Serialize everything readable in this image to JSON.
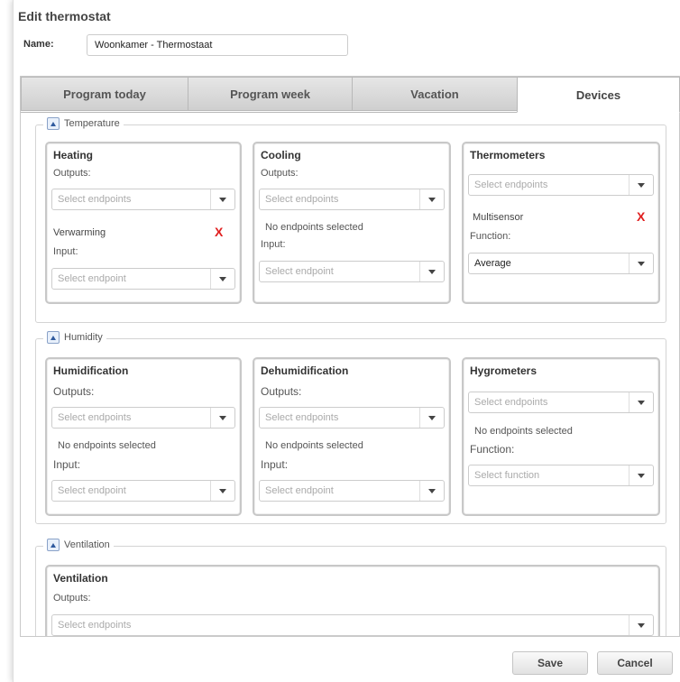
{
  "dialog": {
    "title": "Edit thermostat"
  },
  "name": {
    "label": "Name:",
    "value": "Woonkamer - Thermostaat"
  },
  "tabs": [
    {
      "label": "Program today"
    },
    {
      "label": "Program week"
    },
    {
      "label": "Vacation"
    },
    {
      "label": "Devices"
    }
  ],
  "active_tab": "Devices",
  "temperature": {
    "legend": "Temperature",
    "heating": {
      "title": "Heating",
      "outputs_label": "Outputs:",
      "outputs_placeholder": "Select endpoints",
      "item": "Verwarming",
      "remove": "X",
      "input_label": "Input:",
      "input_placeholder": "Select endpoint"
    },
    "cooling": {
      "title": "Cooling",
      "outputs_label": "Outputs:",
      "outputs_placeholder": "Select endpoints",
      "none_text": "No endpoints selected",
      "input_label": "Input:",
      "input_placeholder": "Select endpoint"
    },
    "thermometers": {
      "title": "Thermometers",
      "select_placeholder": "Select endpoints",
      "item": "Multisensor",
      "remove": "X",
      "function_label": "Function:",
      "function_value": "Average"
    }
  },
  "humidity": {
    "legend": "Humidity",
    "humidification": {
      "title": "Humidification",
      "outputs_label": "Outputs:",
      "outputs_placeholder": "Select endpoints",
      "none_text": "No endpoints selected",
      "input_label": "Input:",
      "input_placeholder": "Select endpoint"
    },
    "dehumidification": {
      "title": "Dehumidification",
      "outputs_label": "Outputs:",
      "outputs_placeholder": "Select endpoints",
      "none_text": "No endpoints selected",
      "input_label": "Input:",
      "input_placeholder": "Select endpoint"
    },
    "hygrometers": {
      "title": "Hygrometers",
      "select_placeholder": "Select endpoints",
      "none_text": "No endpoints selected",
      "function_label": "Function:",
      "function_placeholder": "Select function"
    }
  },
  "ventilation": {
    "legend": "Ventilation",
    "card": {
      "title": "Ventilation",
      "outputs_label": "Outputs:",
      "outputs_placeholder": "Select endpoints"
    }
  },
  "buttons": {
    "save": "Save",
    "cancel": "Cancel"
  }
}
